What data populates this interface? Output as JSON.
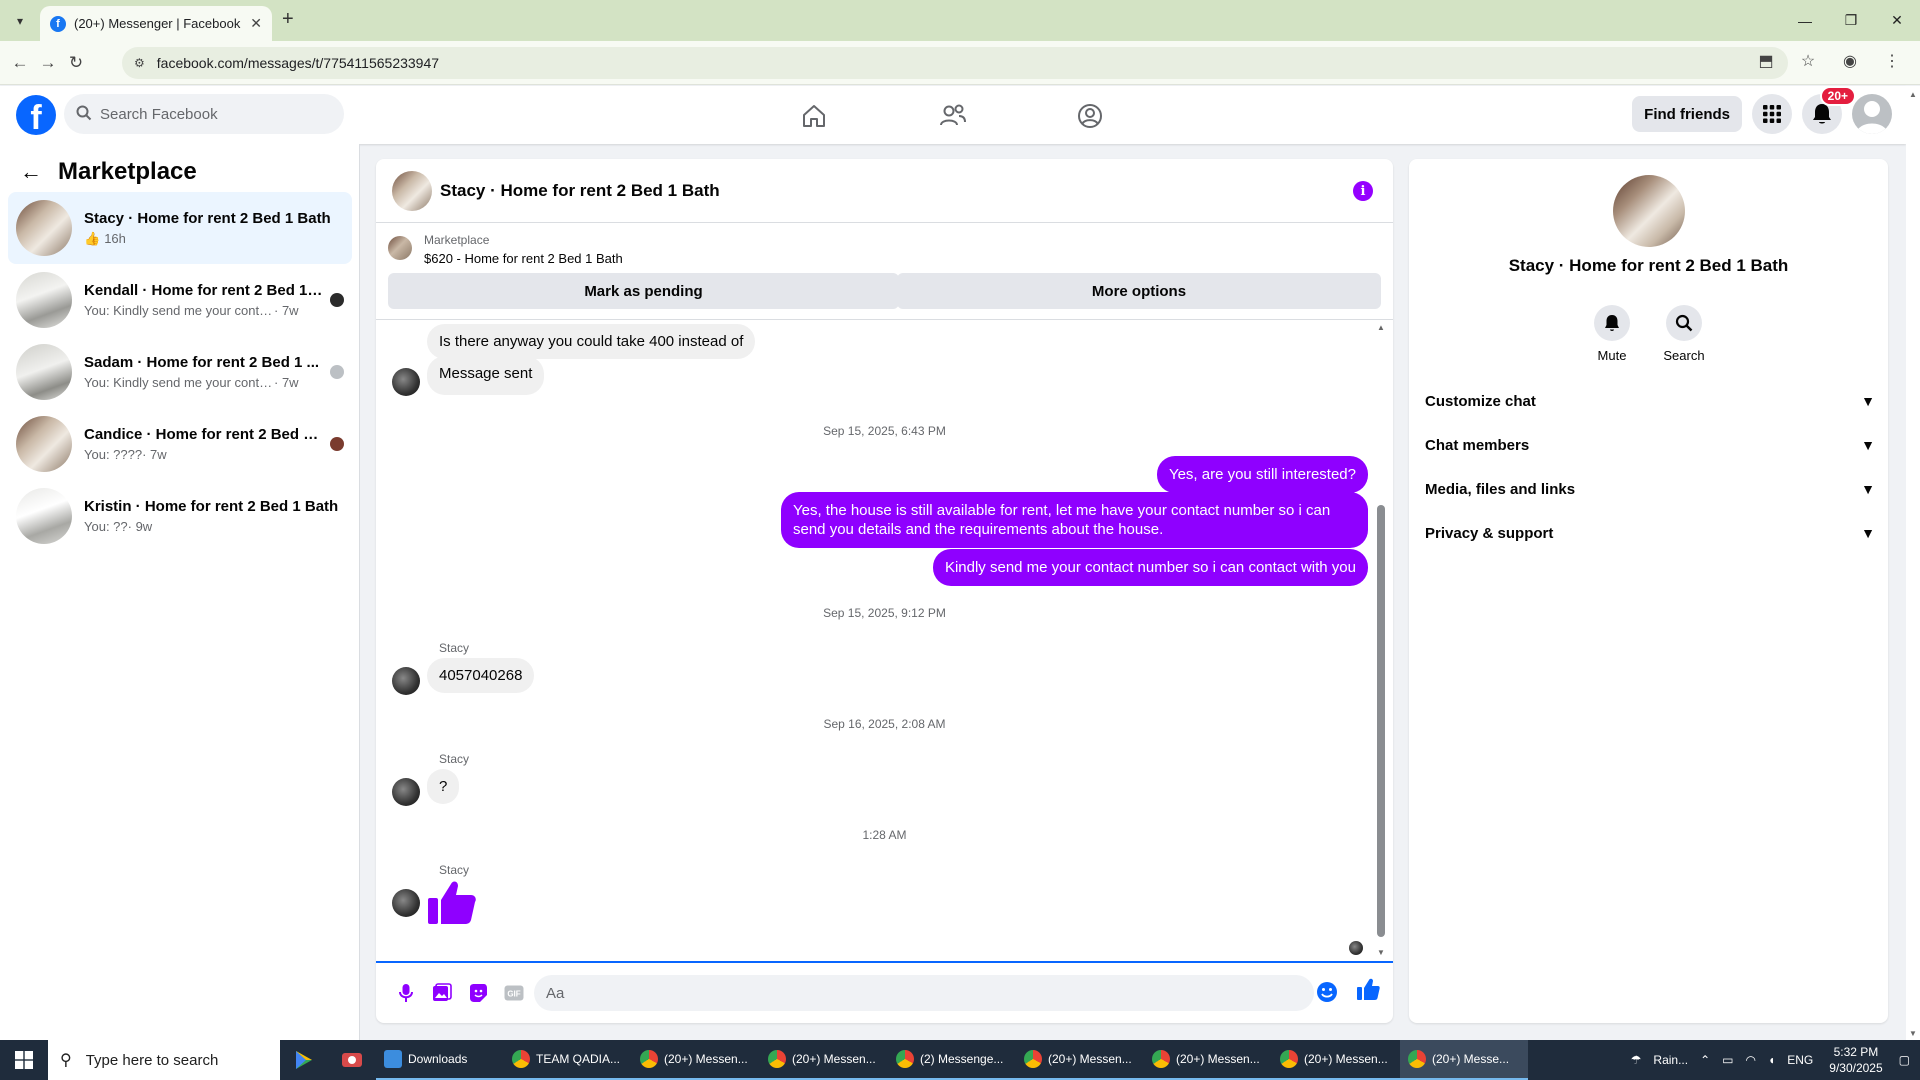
{
  "browser": {
    "tab_title": "(20+) Messenger | Facebook",
    "url": "facebook.com/messages/t/775411565233947"
  },
  "header": {
    "search_placeholder": "Search Facebook",
    "find_friends": "Find friends",
    "notif_badge": "20+"
  },
  "sidebar": {
    "title": "Marketplace",
    "conversations": [
      {
        "name": "Stacy · Home for rent 2 Bed 1 Bath",
        "snippet": "",
        "time": "16h",
        "liked": true,
        "active": true
      },
      {
        "name": "Kendall · Home for rent 2 Bed 1 ...",
        "snippet": "You: Kindly send me your contact ...",
        "time": "· 7w"
      },
      {
        "name": "Sadam · Home for rent 2 Bed 1 ...",
        "snippet": "You: Kindly send me your contact ...",
        "time": "· 7w"
      },
      {
        "name": "Candice · Home for rent 2 Bed 1 ...",
        "snippet": "You: ????",
        "time": " · 7w"
      },
      {
        "name": "Kristin · Home for rent 2 Bed 1 Bath",
        "snippet": "You: ??",
        "time": " · 9w"
      }
    ]
  },
  "chat": {
    "title": "Stacy · Home for rent 2 Bed 1 Bath",
    "listing": {
      "source": "Marketplace",
      "title": "$620 - Home for rent 2 Bed 1 Bath",
      "btn_pending": "Mark as pending",
      "btn_more": "More options"
    },
    "messages": {
      "in1": "Is there anyway you could take 400 instead of",
      "in2": "Message sent",
      "ts1": "Sep 15, 2025, 6:43 PM",
      "out1": "Yes, are you still interested?",
      "out2": "Yes, the house is still available for rent, let me have your contact number so i can send you details and the requirements about the house.",
      "out3": "Kindly send me your contact number so i can contact with you",
      "ts2": "Sep 15, 2025, 9:12 PM",
      "sender": "Stacy",
      "in3": "4057040268",
      "ts3": "Sep 16, 2025, 2:08 AM",
      "in4": "?",
      "ts4": "1:28 AM"
    },
    "composer_placeholder": "Aa"
  },
  "rpanel": {
    "name": "Stacy · Home for rent 2 Bed 1 Bath",
    "mute": "Mute",
    "search": "Search",
    "rows": [
      "Customize chat",
      "Chat members",
      "Media, files and links",
      "Privacy & support"
    ]
  },
  "taskbar": {
    "search_placeholder": "Type here to search",
    "items": [
      "Downloads",
      "TEAM QADIA...",
      "(20+) Messen...",
      "(20+) Messen...",
      "(2) Messenge...",
      "(20+) Messen...",
      "(20+) Messen...",
      "(20+) Messen...",
      "(20+) Messe..."
    ],
    "weather": "Rain...",
    "lang": "ENG",
    "time": "5:32 PM",
    "date": "9/30/2025"
  },
  "colors": {
    "fb_blue": "#0866ff",
    "outgoing": "#8f00ff",
    "notif_red": "#e41e3f"
  }
}
